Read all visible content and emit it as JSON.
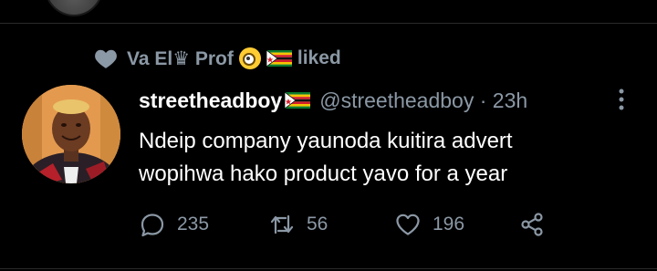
{
  "context": {
    "liker_name": "Va El♛ Prof",
    "liked_label": "liked"
  },
  "tweet": {
    "display_name": "streetheadboy",
    "handle": "@streetheadboy",
    "separator": "·",
    "time": "23h",
    "text_line1": "Ndeip company yaunoda kuitira advert",
    "text_line2": "wopihwa hako product yavo for a year"
  },
  "actions": {
    "reply_count": "235",
    "retweet_count": "56",
    "like_count": "196"
  },
  "colors": {
    "background": "#000000",
    "primary_text": "#ffffff",
    "secondary_text": "#8b98a5",
    "divider": "#2a2a2a"
  },
  "icons": {
    "context": "heart-icon",
    "reply": "comment-icon",
    "retweet": "retweet-icon",
    "like": "heart-outline-icon",
    "share": "share-icon",
    "more": "more-vertical-icon",
    "flag": "zimbabwe-flag-icon",
    "face_emoji": "face-with-monocle-icon"
  }
}
